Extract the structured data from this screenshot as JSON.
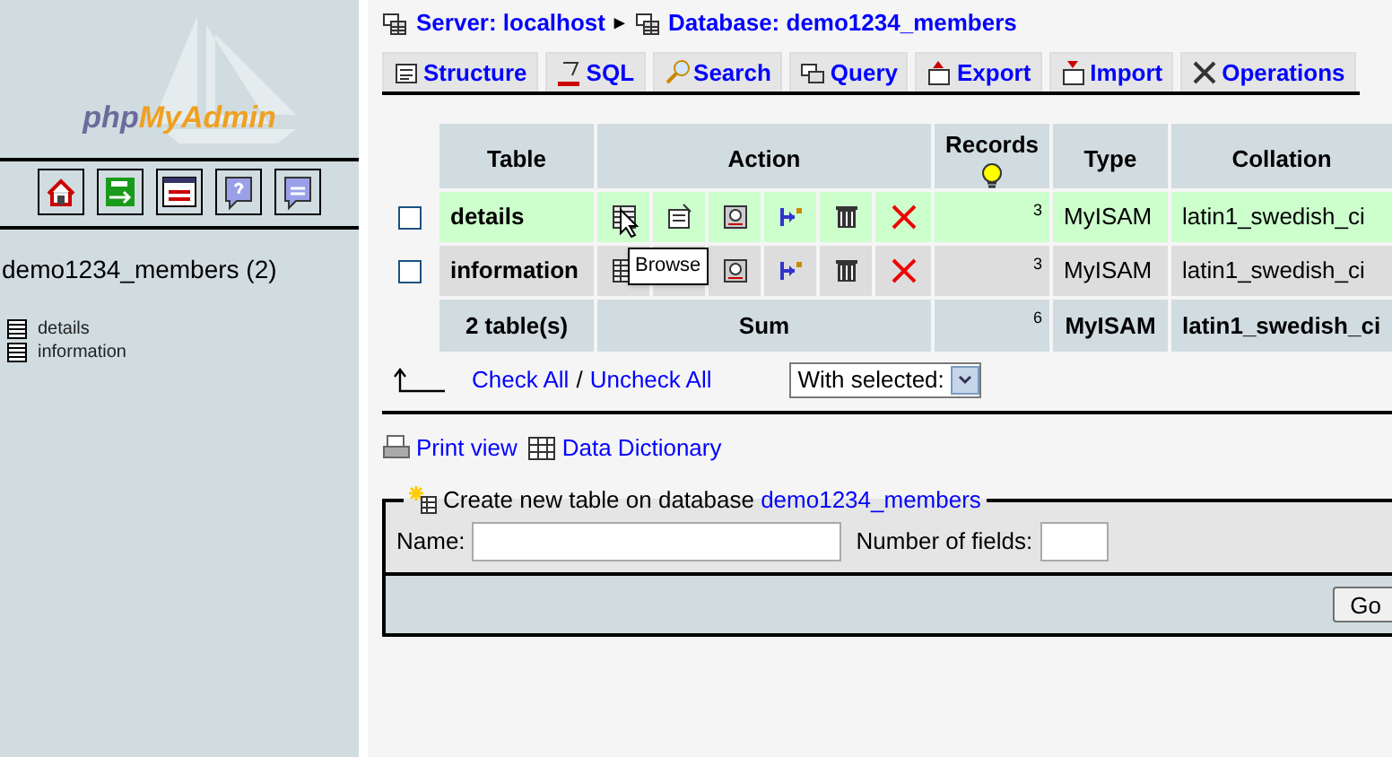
{
  "sidebar": {
    "logo_parts": [
      "php",
      "MyAdmin"
    ],
    "database": "demo1234_members (2)",
    "tables": [
      "details",
      "information"
    ]
  },
  "breadcrumb": {
    "server": "Server: localhost",
    "separator": "▸",
    "database": "Database: demo1234_members"
  },
  "tabs": [
    {
      "label": "Structure",
      "selected": false
    },
    {
      "label": "SQL",
      "selected": false
    },
    {
      "label": "Search",
      "selected": false
    },
    {
      "label": "Query",
      "selected": false
    },
    {
      "label": "Export",
      "selected": false
    },
    {
      "label": "Import",
      "selected": false
    },
    {
      "label": "Operations",
      "selected": false
    }
  ],
  "table": {
    "columns": [
      "Table",
      "Action",
      "Records",
      "Type",
      "Collation"
    ],
    "rows": [
      {
        "name": "details",
        "records": "3",
        "type": "MyISAM",
        "collation": "latin1_swedish_ci",
        "checked": false,
        "highlighted": true
      },
      {
        "name": "information",
        "records": "3",
        "type": "MyISAM",
        "collation": "latin1_swedish_ci",
        "checked": false,
        "highlighted": false
      }
    ],
    "footer": {
      "count": "2 table(s)",
      "sum": "Sum",
      "records": "6",
      "type": "MyISAM",
      "collation": "latin1_swedish_ci"
    }
  },
  "tooltip": "Browse",
  "check_all": "Check All",
  "slash": "/",
  "uncheck_all": "Uncheck All",
  "with_selected": "With selected:",
  "links": [
    {
      "label": "Print view"
    },
    {
      "label": "Data Dictionary"
    }
  ],
  "create": {
    "legend": "Create new table on database",
    "database_link": "demo1234_members",
    "name_label": "Name:",
    "fields_label": "Number of fields:",
    "button": "Go"
  }
}
